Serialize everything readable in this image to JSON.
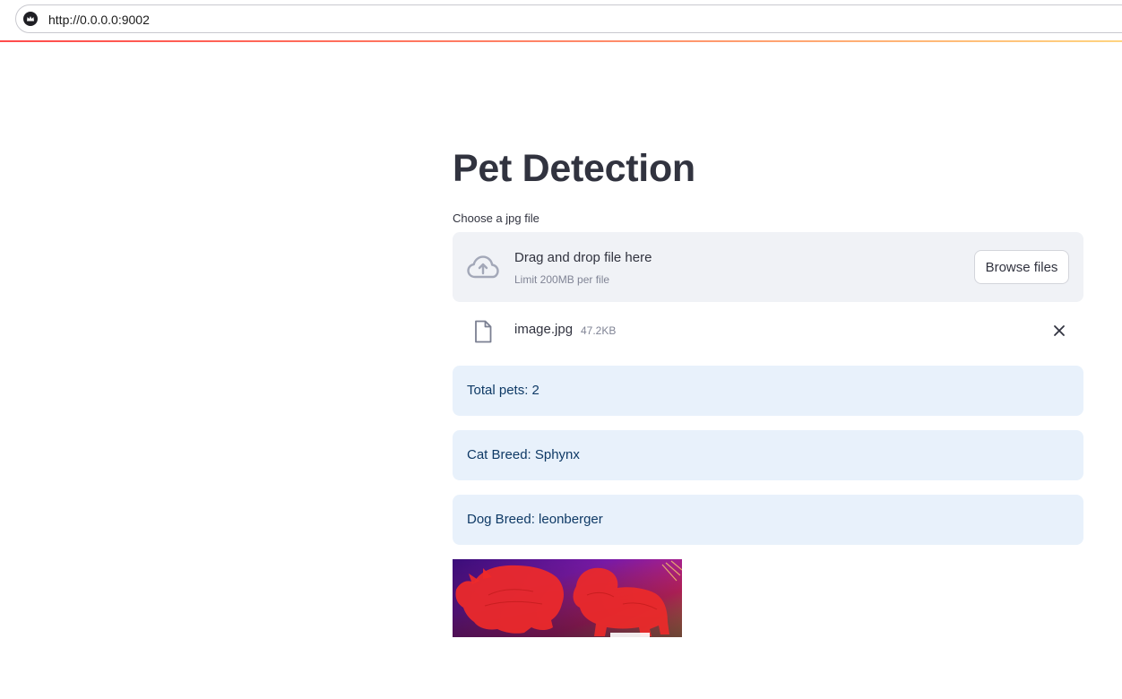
{
  "browser": {
    "url": "http://0.0.0.0:9002",
    "site_icon": "streamlit-crown-icon"
  },
  "main": {
    "title": "Pet Detection",
    "uploader": {
      "label": "Choose a jpg file",
      "drop_text": "Drag and drop file here",
      "limit_text": "Limit 200MB per file",
      "browse_label": "Browse files",
      "icon": "cloud-upload-icon"
    },
    "uploaded_file": {
      "name": "image.jpg",
      "size": "47.2KB",
      "icon": "file-icon",
      "remove_icon": "close-icon"
    },
    "results": [
      {
        "text": "Total pets: 2"
      },
      {
        "text": "Cat Breed: Sphynx"
      },
      {
        "text": "Dog Breed: leonberger"
      }
    ]
  },
  "colors": {
    "accent": "#ff4b4b",
    "info_bg": "#e8f1fb",
    "info_text": "#0f3a66",
    "dropzone_bg": "#f0f2f6"
  }
}
